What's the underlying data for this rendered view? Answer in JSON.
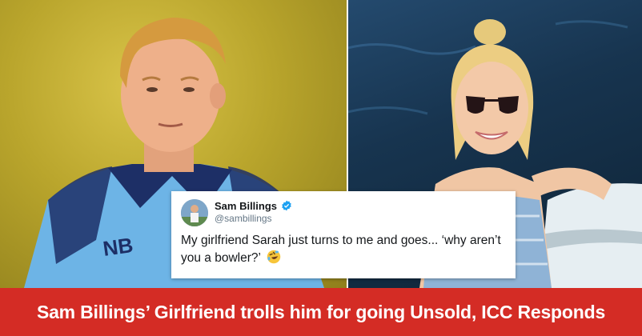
{
  "left_photo": {
    "subject": "man-in-blue-cricket-jersey"
  },
  "right_photo": {
    "subject": "woman-in-sunglasses"
  },
  "tweet": {
    "display_name": "Sam Billings",
    "handle": "@sambillings",
    "verified_icon": "verified-badge-icon",
    "text": "My girlfriend Sarah just turns to me and goes... ‘why aren’t you a bowler?’",
    "emoji": "rolling-on-floor-laughing-emoji"
  },
  "banner": {
    "headline": "Sam Billings’ Girlfriend trolls him for going Unsold, ICC Responds",
    "color": "#d42c25"
  }
}
